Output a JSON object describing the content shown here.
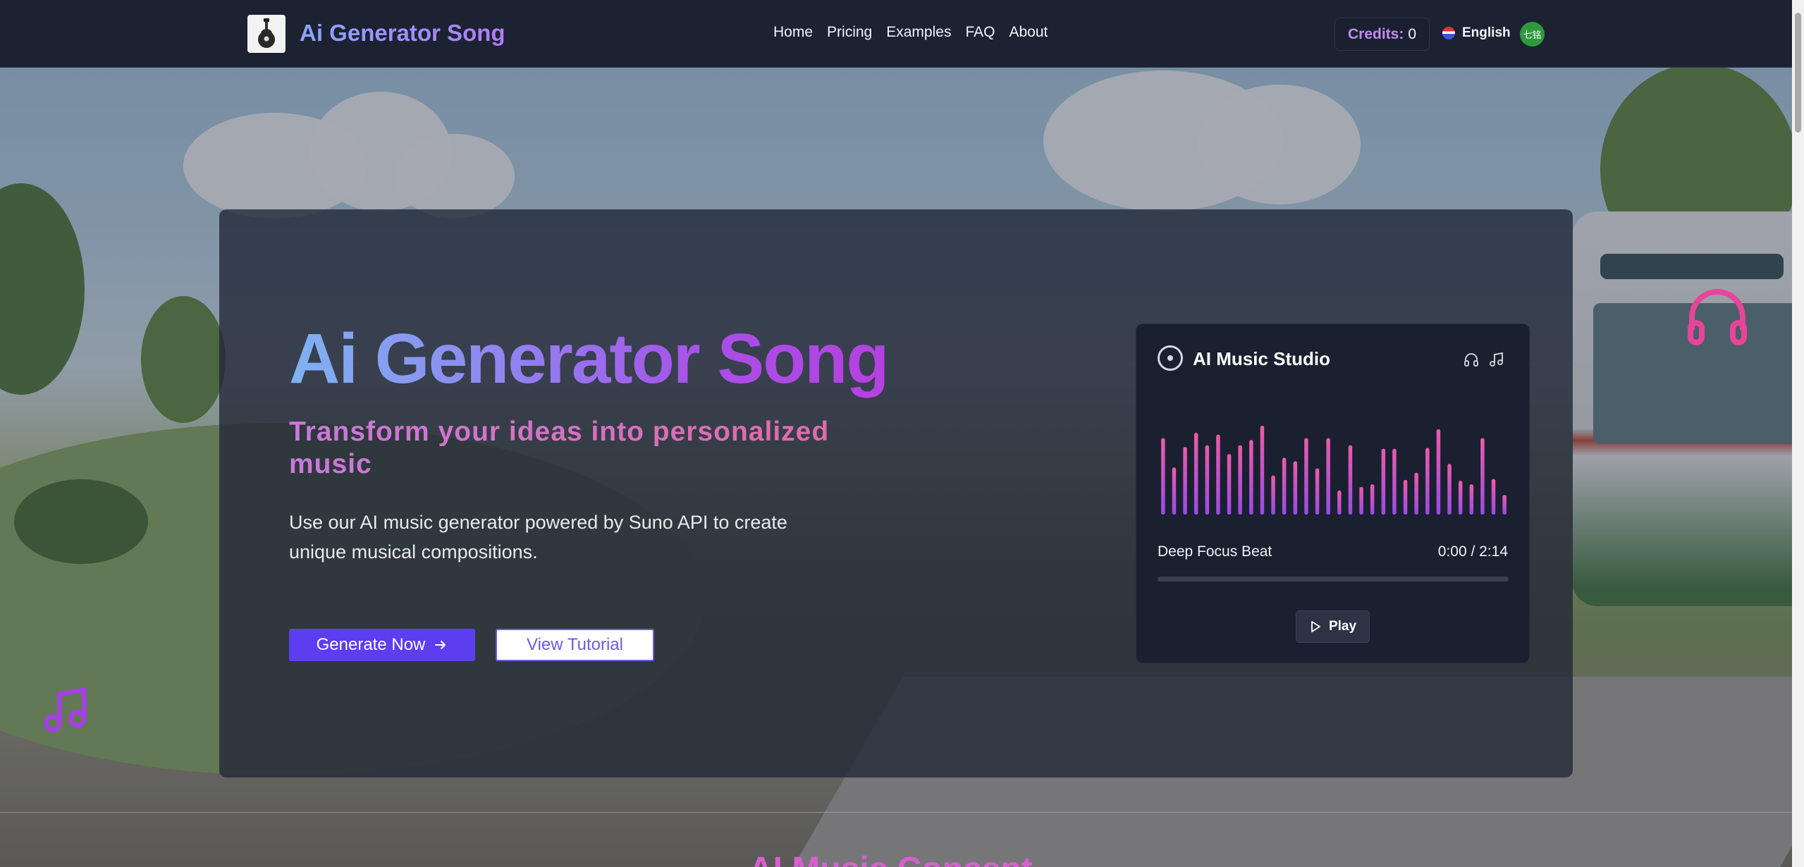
{
  "header": {
    "brand": "Ai Generator Song",
    "nav": [
      "Home",
      "Pricing",
      "Examples",
      "FAQ",
      "About"
    ],
    "credits_label": "Credits:",
    "credits_value": "0",
    "language": "English",
    "avatar_text": "七铭"
  },
  "hero": {
    "title": "Ai Generator Song",
    "subtitle": "Transform your ideas into personalized music",
    "description": "Use our AI music generator powered by Suno API to create unique musical compositions.",
    "primary_button": "Generate Now",
    "secondary_button": "View Tutorial"
  },
  "studio": {
    "title": "AI Music Studio",
    "track_name": "Deep Focus Beat",
    "time": "0:00 / 2:14",
    "progress": 0,
    "play_label": "Play",
    "equalizer_levels": [
      0.86,
      0.53,
      0.76,
      0.92,
      0.78,
      0.9,
      0.68,
      0.78,
      0.84,
      1.0,
      0.44,
      0.64,
      0.6,
      0.86,
      0.52,
      0.86,
      0.27,
      0.78,
      0.31,
      0.34,
      0.74,
      0.74,
      0.39,
      0.47,
      0.75,
      0.96,
      0.57,
      0.38,
      0.34,
      0.86,
      0.4,
      0.22
    ]
  },
  "next_section": {
    "heading": "AI Music Concept"
  },
  "colors": {
    "accent_purple": "#5c3df0",
    "brand_gradient_start": "#8aa6ff",
    "brand_gradient_end": "#b07cf5",
    "equalizer_top": "#ec5aa8",
    "equalizer_bottom": "#9a4be6",
    "decoration_pink": "#e8449a",
    "decoration_purple": "#a43ee6"
  },
  "icons": {
    "logo": "guitar-icon",
    "primary_button": "arrow-right-icon",
    "studio_title": "disc-icon",
    "studio_actions": [
      "headphones-icon",
      "music-note-icon"
    ],
    "play": "play-icon",
    "decorations": [
      "headphones-icon",
      "music-note-icon"
    ]
  }
}
